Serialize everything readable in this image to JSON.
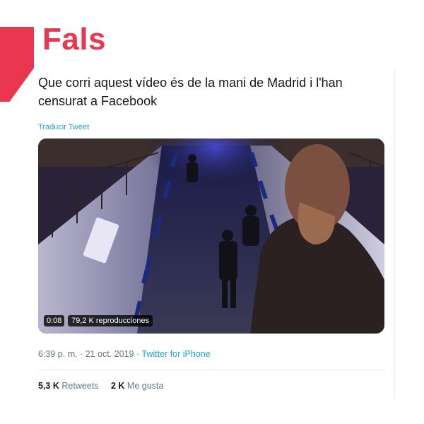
{
  "verdict": "Fals",
  "tweet": {
    "text": "Que corri aquest vídeo és de la mani de Madrid i l'han censurat a Facebook",
    "translate_label": "Traducir Tweet",
    "video": {
      "duration": "0:08",
      "views": "79,2 K reproducciones"
    },
    "time": "6:39 p. m.",
    "separator1": " · ",
    "date": "21 oct. 2019",
    "separator2": " · ",
    "source": "Twitter for iPhone",
    "retweets_count": "5,3 K",
    "retweets_label": "Retweets",
    "likes_count": "2 K",
    "likes_label": "Me gusta"
  },
  "colors": {
    "accent": "#e8374e",
    "link": "#1da1f2",
    "muted": "#657786"
  }
}
